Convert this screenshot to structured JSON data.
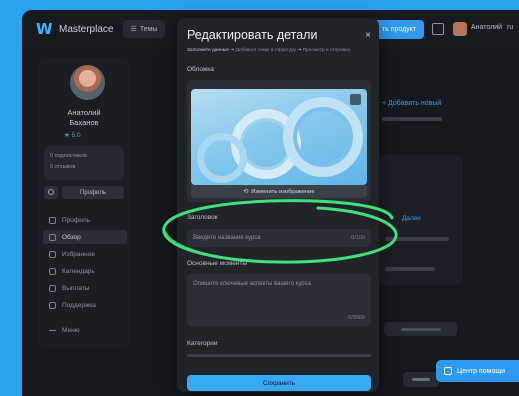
{
  "topbar": {
    "brand": "Masterplace",
    "themes_label": "Темы",
    "create_label": "ть продукт",
    "user_name": "Анатолий",
    "lang": "ru"
  },
  "sidebar": {
    "first_name": "Анатолий",
    "last_name": "Баханов",
    "rating": "5.0",
    "stats": [
      "0 подписчиков",
      "0 отзывов"
    ],
    "profile_button": "Профиль",
    "nav": [
      {
        "label": "Профиль",
        "icon": "profile-icon",
        "active": false
      },
      {
        "label": "Обзор",
        "icon": "overview-icon",
        "active": true
      },
      {
        "label": "Избранное",
        "icon": "star-icon",
        "active": false
      },
      {
        "label": "Календарь",
        "icon": "calendar-icon",
        "active": false
      },
      {
        "label": "Выплаты",
        "icon": "wallet-icon",
        "active": false
      },
      {
        "label": "Поддержка",
        "icon": "support-icon",
        "active": false
      },
      {
        "label": "Меню",
        "icon": "menu-icon",
        "active": false
      }
    ]
  },
  "background": {
    "add_new": "+ Добавить новый",
    "next_label": "Далее",
    "help_label": "Центр помощи"
  },
  "modal": {
    "title": "Редактировать детали",
    "close": "×",
    "steps": [
      "Заполните данные",
      "Добавьте темы и структуру",
      "Просмотр и отправка"
    ],
    "cover_label": "Обложка",
    "change_image": "Изменить изображение",
    "title_label": "Заголовок",
    "title_placeholder": "Введите название курса",
    "title_counter": "0/100",
    "features_label": "Основные моменты",
    "features_placeholder": "Опишите ключевые аспекты вашего курса",
    "features_counter": "0/3000",
    "categories_label": "Категории",
    "save_label": "Сохранить"
  },
  "colors": {
    "frame_bg": "#29a3ee",
    "accent": "#37a8f2",
    "annotation": "#3ee07a"
  }
}
